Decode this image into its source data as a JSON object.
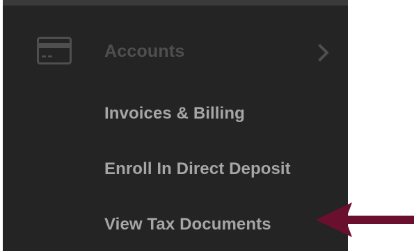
{
  "colors": {
    "sidebar_bg": "#242424",
    "header_text": "#4f4f4f",
    "item_text": "#a6a6a6",
    "arrow": "#6b0f2e"
  },
  "menu": {
    "header": {
      "icon": "credit-card-icon",
      "label": "Accounts",
      "chevron_icon": "chevron-right-icon"
    },
    "items": [
      {
        "label": "Invoices & Billing"
      },
      {
        "label": "Enroll In Direct Deposit"
      },
      {
        "label": "View Tax Documents"
      }
    ]
  },
  "annotation": {
    "icon": "arrow-left-icon",
    "points_to": "View Tax Documents"
  }
}
